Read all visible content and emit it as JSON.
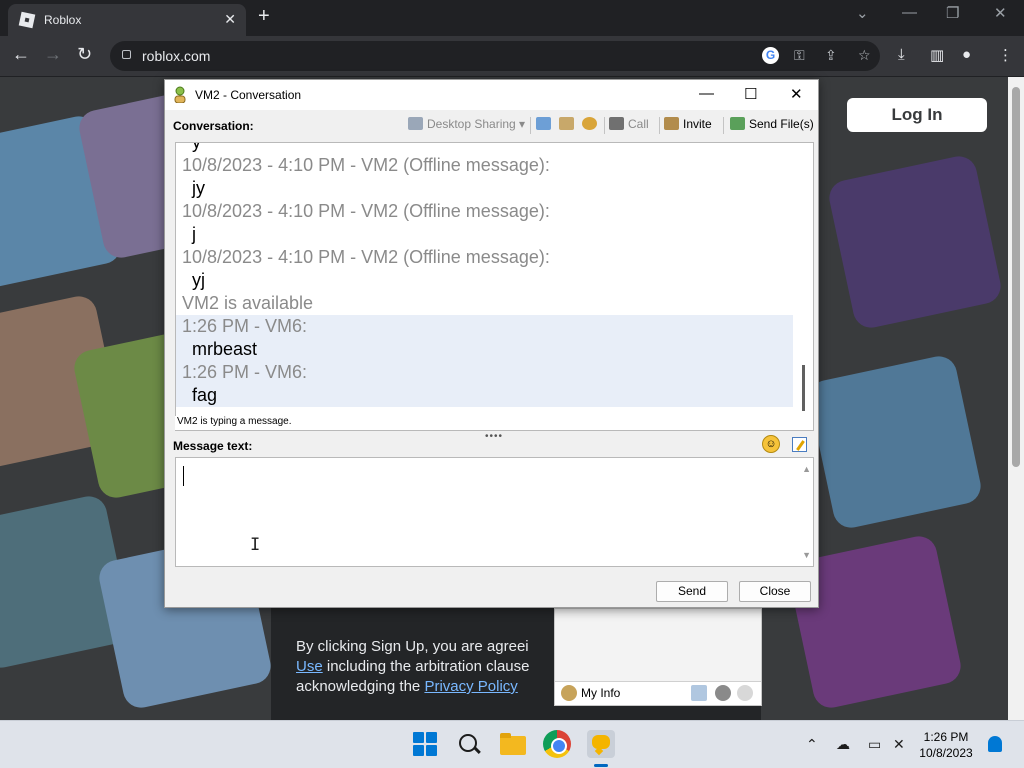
{
  "browser": {
    "tab_title": "Roblox",
    "tab_close": "✕",
    "new_tab": "+",
    "url": "roblox.com",
    "min": "⌄",
    "window_min": "—",
    "window_restore": "❐",
    "window_close": "✕",
    "back": "←",
    "forward": "→",
    "reload": "↻"
  },
  "page": {
    "login_label": "Log In",
    "terms_prefix": "By clicking Sign Up, you are agreei",
    "terms_use": "Use",
    "terms_mid": " including the arbitration clause",
    "terms_ack": "acknowledging the ",
    "terms_privacy": "Privacy Policy"
  },
  "conversation": {
    "title": "VM2 - Conversation",
    "conversation_label": "Conversation:",
    "toolbar": {
      "desktop_sharing": "Desktop Sharing",
      "call": "Call",
      "invite": "Invite",
      "send_files": "Send File(s)"
    },
    "messages": [
      {
        "kind": "body",
        "text": "y"
      },
      {
        "kind": "hdr",
        "text": "10/8/2023 - 4:10 PM - VM2 (Offline message):"
      },
      {
        "kind": "body",
        "text": "jy"
      },
      {
        "kind": "hdr",
        "text": "10/8/2023 - 4:10 PM - VM2 (Offline message):"
      },
      {
        "kind": "body",
        "text": "j"
      },
      {
        "kind": "hdr",
        "text": "10/8/2023 - 4:10 PM - VM2 (Offline message):"
      },
      {
        "kind": "body",
        "text": "yj"
      },
      {
        "kind": "status",
        "text": "VM2 is available"
      },
      {
        "kind": "hdr-mine",
        "text": "1:26 PM - VM6:"
      },
      {
        "kind": "body-mine",
        "text": "mrbeast"
      },
      {
        "kind": "hdr-mine",
        "text": "1:26 PM - VM6:"
      },
      {
        "kind": "body-mine",
        "text": "fag"
      }
    ],
    "typing_status": "VM2 is typing a message.",
    "message_label": "Message text:",
    "message_value": "",
    "send_label": "Send",
    "close_label": "Close"
  },
  "contacts": {
    "my_info": "My Info"
  },
  "taskbar": {
    "time": "1:26 PM",
    "date": "10/8/2023"
  },
  "colors": {
    "browser_bg": "#202124",
    "page_bg": "#393b3d",
    "accent": "#0078d4"
  }
}
